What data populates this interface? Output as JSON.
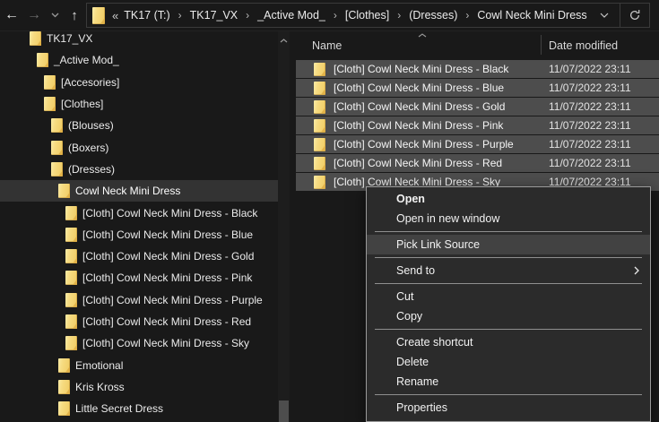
{
  "toolbar": {
    "back_icon": "←",
    "forward_icon": "→",
    "up_icon": "↑",
    "overflow_chevrons": "«",
    "crumb_separator": "›",
    "breadcrumbs": [
      "TK17 (T:)",
      "TK17_VX",
      "_Active Mod_",
      "[Clothes]",
      "(Dresses)",
      "Cowl Neck Mini Dress"
    ]
  },
  "tree": {
    "items": [
      {
        "label": "TK17_VX",
        "level": 0,
        "selected": false
      },
      {
        "label": "_Active Mod_",
        "level": 1,
        "selected": false
      },
      {
        "label": "[Accesories]",
        "level": 2,
        "selected": false
      },
      {
        "label": "[Clothes]",
        "level": 2,
        "selected": false
      },
      {
        "label": "(Blouses)",
        "level": 3,
        "selected": false
      },
      {
        "label": "(Boxers)",
        "level": 3,
        "selected": false
      },
      {
        "label": "(Dresses)",
        "level": 3,
        "selected": false
      },
      {
        "label": "Cowl Neck Mini Dress",
        "level": 4,
        "selected": true
      },
      {
        "label": "[Cloth] Cowl Neck Mini Dress - Black",
        "level": 5,
        "selected": false
      },
      {
        "label": "[Cloth] Cowl Neck Mini Dress - Blue",
        "level": 5,
        "selected": false
      },
      {
        "label": "[Cloth] Cowl Neck Mini Dress - Gold",
        "level": 5,
        "selected": false
      },
      {
        "label": "[Cloth] Cowl Neck Mini Dress - Pink",
        "level": 5,
        "selected": false
      },
      {
        "label": "[Cloth] Cowl Neck Mini Dress - Purple",
        "level": 5,
        "selected": false
      },
      {
        "label": "[Cloth] Cowl Neck Mini Dress - Red",
        "level": 5,
        "selected": false
      },
      {
        "label": "[Cloth] Cowl Neck Mini Dress - Sky",
        "level": 5,
        "selected": false
      },
      {
        "label": "Emotional",
        "level": 4,
        "selected": false
      },
      {
        "label": "Kris Kross",
        "level": 4,
        "selected": false
      },
      {
        "label": "Little Secret Dress",
        "level": 4,
        "selected": false
      }
    ]
  },
  "files": {
    "columns": {
      "name": "Name",
      "date": "Date modified"
    },
    "sort_ascending": true,
    "rows": [
      {
        "name": "[Cloth] Cowl Neck Mini Dress - Black",
        "date": "11/07/2022 23:11",
        "selected": true
      },
      {
        "name": "[Cloth] Cowl Neck Mini Dress - Blue",
        "date": "11/07/2022 23:11",
        "selected": true
      },
      {
        "name": "[Cloth] Cowl Neck Mini Dress - Gold",
        "date": "11/07/2022 23:11",
        "selected": true
      },
      {
        "name": "[Cloth] Cowl Neck Mini Dress - Pink",
        "date": "11/07/2022 23:11",
        "selected": true
      },
      {
        "name": "[Cloth] Cowl Neck Mini Dress - Purple",
        "date": "11/07/2022 23:11",
        "selected": true
      },
      {
        "name": "[Cloth] Cowl Neck Mini Dress - Red",
        "date": "11/07/2022 23:11",
        "selected": true
      },
      {
        "name": "[Cloth] Cowl Neck Mini Dress - Sky",
        "date": "11/07/2022 23:11",
        "selected": true
      }
    ]
  },
  "context_menu": {
    "items": [
      {
        "label": "Open",
        "bold": true
      },
      {
        "label": "Open in new window"
      },
      {
        "type": "separator"
      },
      {
        "label": "Pick Link Source",
        "highlighted": true
      },
      {
        "type": "separator"
      },
      {
        "label": "Send to",
        "submenu": true
      },
      {
        "type": "separator"
      },
      {
        "label": "Cut"
      },
      {
        "label": "Copy"
      },
      {
        "type": "separator"
      },
      {
        "label": "Create shortcut"
      },
      {
        "label": "Delete"
      },
      {
        "label": "Rename"
      },
      {
        "type": "separator"
      },
      {
        "label": "Properties"
      }
    ]
  },
  "colors": {
    "window_bg": "#191919",
    "file_selection": "#4d4d4d",
    "tree_selection": "#333333",
    "menu_bg": "#2b2b2b",
    "menu_highlight": "#424242",
    "menu_border": "#9a9a9a",
    "folder_yellow": "#f2d377"
  }
}
